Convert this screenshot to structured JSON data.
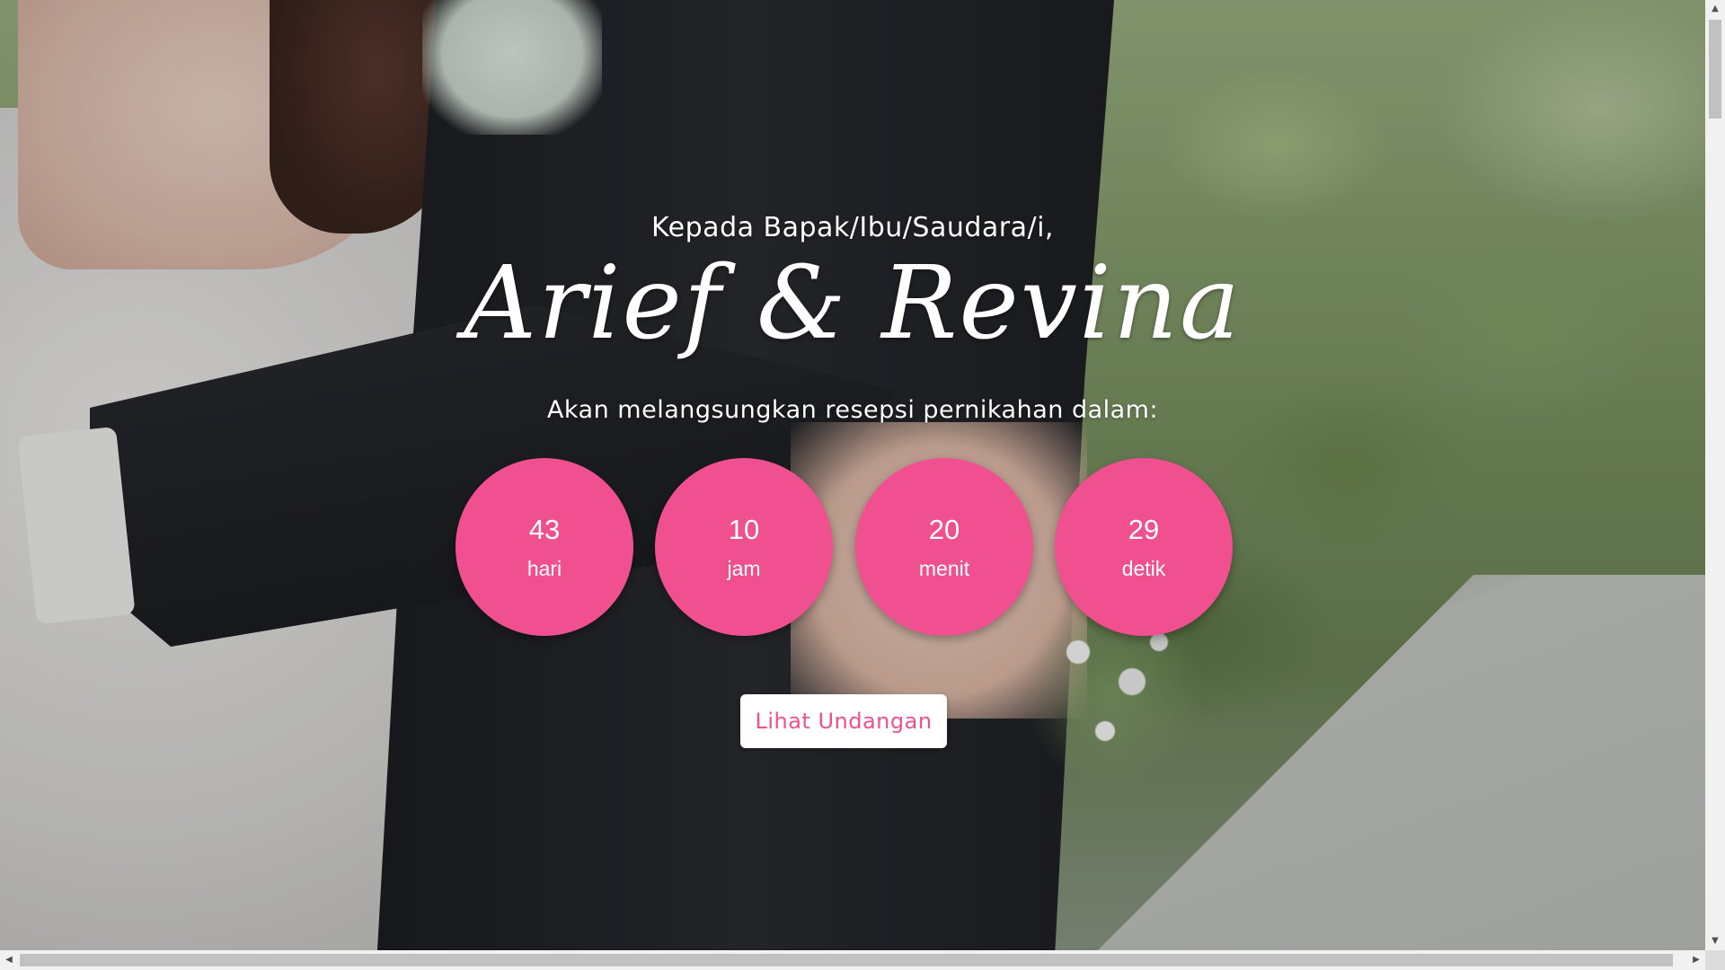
{
  "hero": {
    "greeting": "Kepada Bapak/Ibu/Saudara/i,",
    "couple_names": "Arief & Revina",
    "subtitle": "Akan melangsungkan resepsi pernikahan dalam:"
  },
  "countdown": [
    {
      "value": "43",
      "unit": "hari"
    },
    {
      "value": "10",
      "unit": "jam"
    },
    {
      "value": "20",
      "unit": "menit"
    },
    {
      "value": "29",
      "unit": "detik"
    }
  ],
  "cta": {
    "label": "Lihat Undangan"
  },
  "colors": {
    "accent": "#f0508f",
    "text": "#ffffff",
    "button_bg": "#ffffff"
  },
  "icons": {
    "scroll_up": "triangle-up-icon",
    "scroll_down": "triangle-down-icon",
    "scroll_left": "triangle-left-icon",
    "scroll_right": "triangle-right-icon"
  }
}
